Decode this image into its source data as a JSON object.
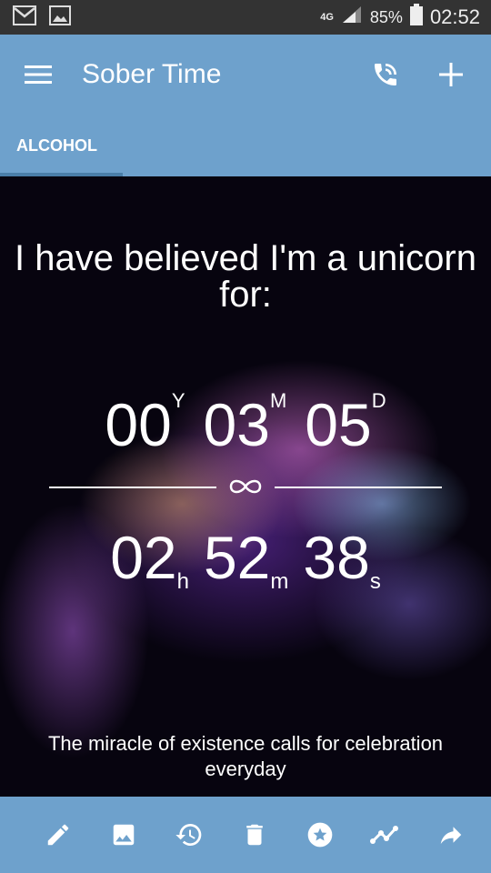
{
  "status_bar": {
    "network": "4G",
    "battery": "85%",
    "time": "02:52",
    "icons": [
      "mail-icon",
      "image-icon",
      "signal-icon",
      "battery-icon"
    ]
  },
  "app_bar": {
    "title": "Sober Time",
    "icons": [
      "menu-icon",
      "phone-call-icon",
      "add-icon"
    ]
  },
  "tabs": [
    {
      "label": "ALCOHOL",
      "selected": true
    }
  ],
  "counter": {
    "headline": "I have believed I'm a unicorn for:",
    "years": "00",
    "years_unit": "Y",
    "months": "03",
    "months_unit": "M",
    "days": "05",
    "days_unit": "D",
    "hours": "02",
    "hours_unit": "h",
    "minutes": "52",
    "minutes_unit": "m",
    "seconds": "38",
    "seconds_unit": "s",
    "divider_icon": "infinity-icon"
  },
  "quote": "The miracle of existence calls for celebration everyday",
  "bottom_bar": {
    "icons": [
      "edit-icon",
      "image-icon",
      "history-icon",
      "delete-icon",
      "star-badge-icon",
      "chart-line-icon",
      "share-icon"
    ]
  },
  "colors": {
    "status_bar": "#333333",
    "app_bar": "#6ea1cc",
    "tab_indicator": "#4a7ea8",
    "text": "#ffffff"
  }
}
